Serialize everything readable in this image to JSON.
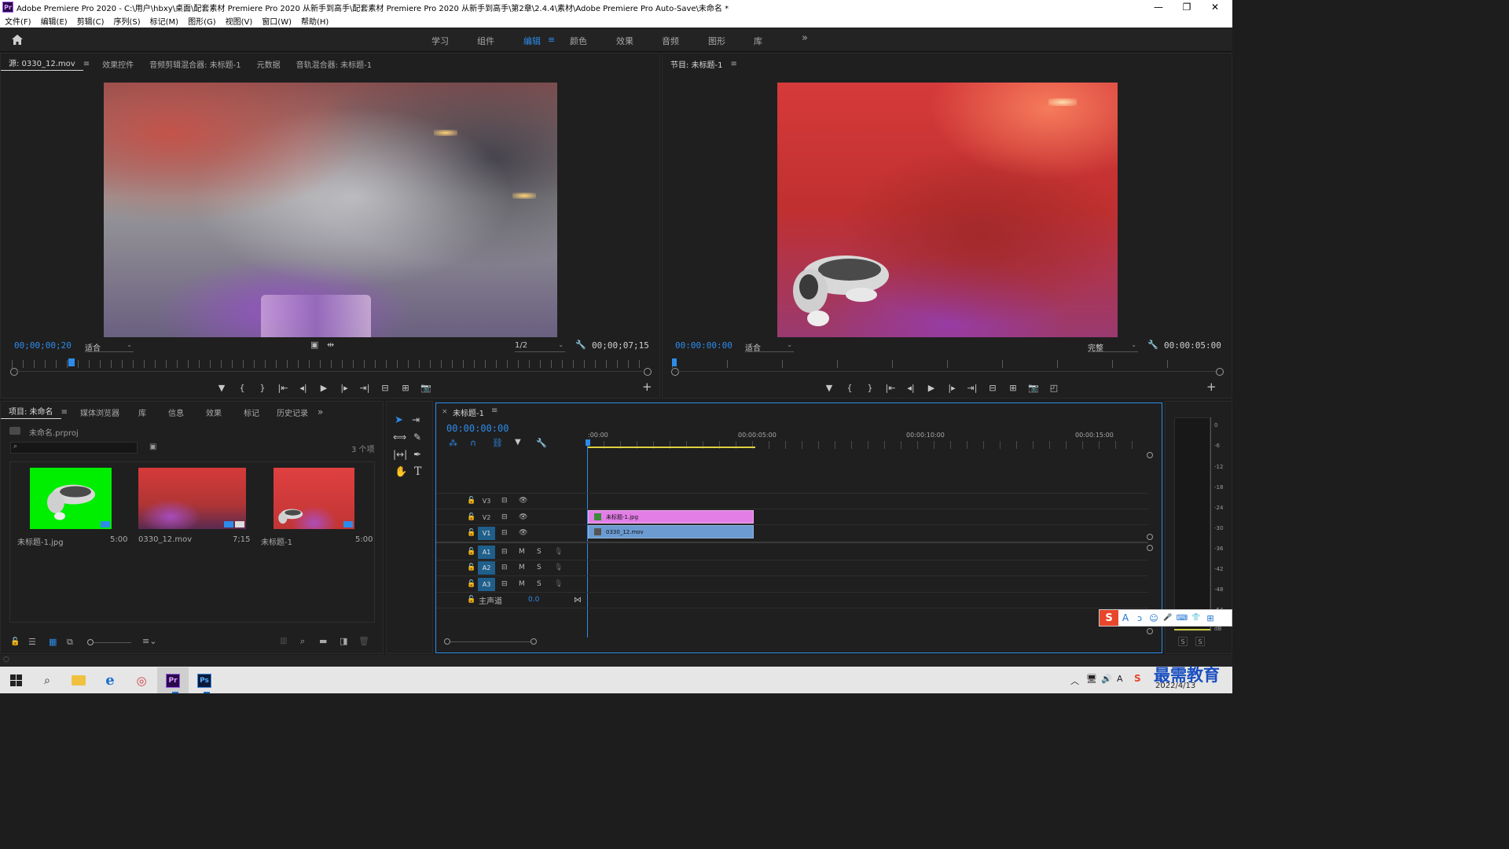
{
  "window": {
    "title": "Adobe Premiere Pro 2020 - C:\\用户\\hbxy\\桌面\\配套素材 Premiere Pro 2020 从新手到高手\\配套素材 Premiere Pro 2020 从新手到高手\\第2章\\2.4.4\\素材\\Adobe Premiere Pro Auto-Save\\未命名 *",
    "logo": "Pr",
    "minimize": "—",
    "restore": "❐",
    "close": "✕"
  },
  "menu": [
    "文件(F)",
    "编辑(E)",
    "剪辑(C)",
    "序列(S)",
    "标记(M)",
    "图形(G)",
    "视图(V)",
    "窗口(W)",
    "帮助(H)"
  ],
  "workspaces": {
    "tabs": [
      "学习",
      "组件",
      "编辑",
      "颜色",
      "效果",
      "音频",
      "图形",
      "库"
    ],
    "active": "编辑",
    "more": "»",
    "menu_icon": "≡"
  },
  "source_panel": {
    "tabs": [
      "源: 0330_12.mov",
      "效果控件",
      "音频剪辑混合器: 未标题-1",
      "元数据",
      "音轨混合器: 未标题-1"
    ],
    "current_time": "00;00;00;20",
    "zoom": "适合",
    "resolution": "1/2",
    "duration": "00;00;07;15",
    "playhead": 0.094
  },
  "program_panel": {
    "tab": "节目: 未标题-1",
    "current_time": "00:00:00:00",
    "zoom": "适合",
    "quality": "完整",
    "duration": "00:00:05:00",
    "playhead": 0.0
  },
  "project_panel": {
    "tabs": [
      "项目: 未命名",
      "媒体浏览器",
      "库",
      "信息",
      "效果",
      "标记",
      "历史记录"
    ],
    "file": "未命名.prproj",
    "item_count": "3 个项",
    "items": [
      {
        "name": "未标题-1.jpg",
        "duration": "5:00"
      },
      {
        "name": "0330_12.mov",
        "duration": "7;15"
      },
      {
        "name": "未标题-1",
        "duration": "5:00"
      }
    ]
  },
  "timeline": {
    "tab": "未标题-1",
    "current_time": "00:00:00:00",
    "ruler": [
      ":00:00",
      "00:00:05:00",
      "00:00:10:00",
      "00:00:15:00"
    ],
    "video_tracks": [
      "V3",
      "V2",
      "V1"
    ],
    "audio_tracks": [
      "A1",
      "A2",
      "A3"
    ],
    "mute": "M",
    "solo": "S",
    "master_label": "主声道",
    "master_value": "0.0",
    "clips": [
      {
        "track": "V2",
        "name": "未标题-1.jpg",
        "color": "#e27ee6"
      },
      {
        "track": "V1",
        "name": "0330_12.mov",
        "color": "#6b9bd1"
      }
    ]
  },
  "meter": {
    "scale": [
      "0",
      "-6",
      "-12",
      "-18",
      "-24",
      "-30",
      "-36",
      "-42",
      "-48",
      "-54",
      "dB"
    ],
    "solo_left": "S",
    "solo_right": "S"
  },
  "ime_bar": {
    "items": [
      "S",
      "A",
      "ↄ",
      "☺",
      "🎤",
      "⌨",
      "👕",
      "⊞"
    ]
  },
  "taskbar": {
    "date": "2022/4/13",
    "watermark": "最需教育",
    "pr_label": "Pr",
    "ps_label": "Ps"
  }
}
